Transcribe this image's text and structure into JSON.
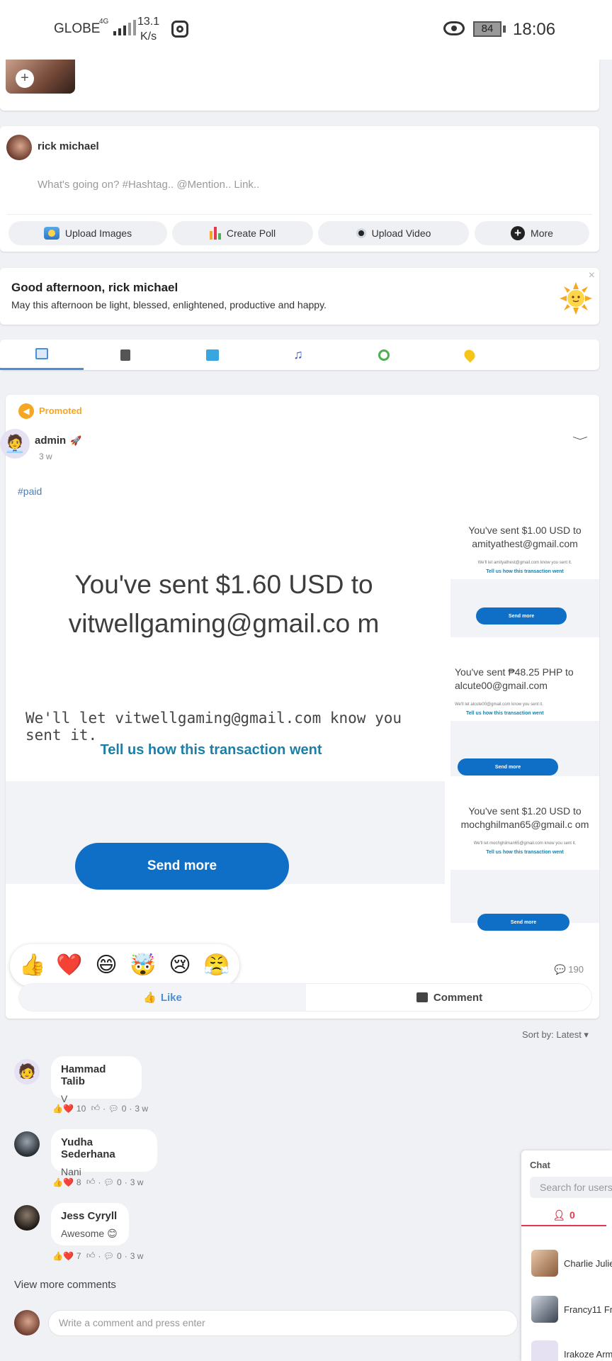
{
  "status_bar": {
    "carrier": "GLOBE",
    "network": "4G",
    "speed_value": "13.1",
    "speed_unit": "K/s",
    "battery": "84",
    "time": "18:06"
  },
  "composer": {
    "user_name": "rick michael",
    "placeholder": "What's going on? #Hashtag.. @Mention.. Link..",
    "buttons": {
      "upload_images": "Upload Images",
      "create_poll": "Create Poll",
      "upload_video": "Upload Video",
      "more": "More"
    }
  },
  "greeting": {
    "title": "Good afternoon, rick michael",
    "subtitle": "May this afternoon be light, blessed, enlightened, productive and happy.",
    "close": "×"
  },
  "post": {
    "promoted_label": "Promoted",
    "author": "admin",
    "time": "3 w",
    "hashtag": "#paid",
    "image_main": {
      "headline": "You've sent $1.60 USD to vitwellgaming@gmail.co m",
      "subline": "We'll let vitwellgaming@gmail.com know you sent it.",
      "link": "Tell us how this transaction went",
      "button": "Send more"
    },
    "image_side": [
      {
        "headline": "You've sent $1.00 USD to amityathest@gmail.com",
        "subline": "We'll let amityathest@gmail.com know you sent it.",
        "link": "Tell us how this transaction went",
        "button": "Send more"
      },
      {
        "headline": "You've sent ₱48.25 PHP to alcute00@gmail.com",
        "subline": "We'll let alcute00@gmail.com know you sent it.",
        "link": "Tell us how this transaction went",
        "button": "Send more"
      },
      {
        "headline": "You've sent $1.20 USD to mochghilman65@gmail.c om",
        "subline": "We'll let mochghilman65@gmail.com know you sent it.",
        "link": "Tell us how this transaction went",
        "button": "Send more"
      }
    ],
    "comment_count": "190",
    "like_label": "Like",
    "comment_label": "Comment",
    "sort_label": "Sort by: Latest ▾"
  },
  "comments": [
    {
      "name": "Hammad Talib",
      "text": "V",
      "reactions": "10",
      "replies": "0",
      "time": "3 w"
    },
    {
      "name": "Yudha Sederhana",
      "text": "Nani",
      "reactions": "8",
      "replies": "0",
      "time": "3 w"
    },
    {
      "name": "Jess Cyryll",
      "text": "Awesome 😊",
      "reactions": "7",
      "replies": "0",
      "time": "3 w"
    }
  ],
  "view_more": "View more comments",
  "write_placeholder": "Write a comment and press enter",
  "chat": {
    "title": "Chat",
    "search_placeholder": "Search for users",
    "online_count": "0",
    "users": [
      "Charlie Julie",
      "Francy11 Fr",
      "Irakoze Arm"
    ]
  },
  "colors": {
    "accent_blue": "#0f6fc6",
    "promoted_orange": "#f5a623",
    "chat_red": "#e53950"
  }
}
